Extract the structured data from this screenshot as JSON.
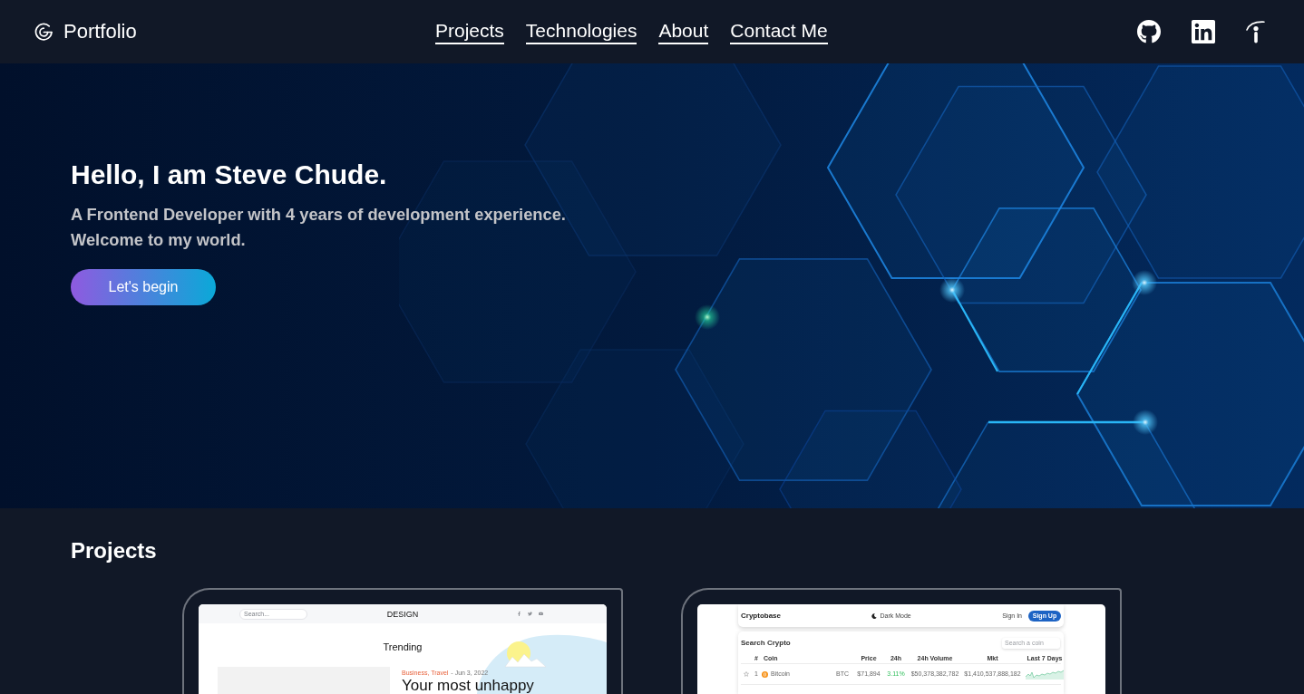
{
  "nav": {
    "logo": "Portfolio",
    "links": [
      {
        "label": "Projects"
      },
      {
        "label": "Technologies"
      },
      {
        "label": "About"
      },
      {
        "label": "Contact Me"
      }
    ]
  },
  "hero": {
    "title": "Hello, I am Steve Chude.",
    "subtitle_lines": [
      "A Frontend Developer with 4 years of development experience.",
      "Welcome to my world."
    ],
    "button": "Let's begin"
  },
  "projects": {
    "heading": "Projects",
    "cards": [
      {
        "kind": "blog",
        "search_placeholder": "Search...",
        "brand": "DESIGN",
        "section_title": "Trending",
        "post": {
          "categories": "Business, Travel",
          "date": "- Jun 3, 2022",
          "title": "Your most unhappy"
        }
      },
      {
        "kind": "crypto",
        "brand": "Cryptobase",
        "mode_toggle": "Dark Mode",
        "sign_in": "Sign In",
        "sign_up": "Sign Up",
        "search_title": "Search Crypto",
        "search_placeholder": "Search a coin",
        "columns": [
          "#",
          "Coin",
          "Price",
          "24h",
          "24h Volume",
          "Mkt",
          "Last 7 Days"
        ],
        "rows": [
          {
            "rank": "1",
            "name": "Bitcoin",
            "symbol": "BTC",
            "price": "$71,894",
            "change": "3.11%",
            "volume": "$50,378,382,782",
            "market_cap": "$1,410,537,888,182"
          }
        ]
      }
    ]
  }
}
